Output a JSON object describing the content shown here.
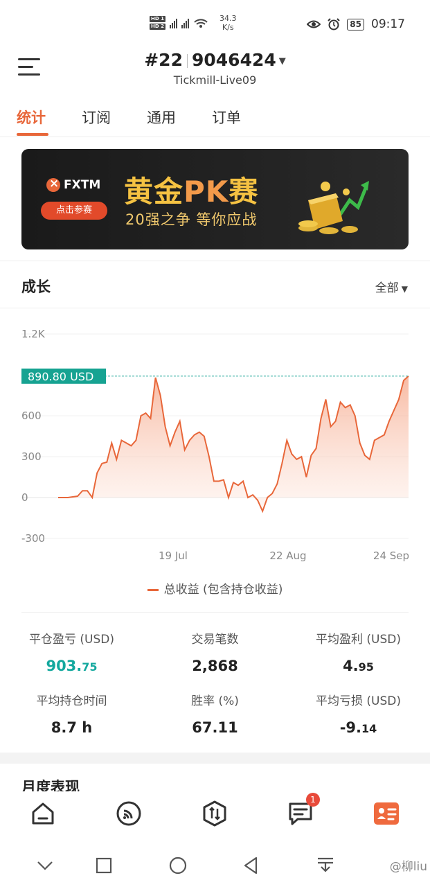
{
  "status_bar": {
    "hd1": "HD 1",
    "hd2": "HD 2",
    "net_speed_value": "34.3",
    "net_speed_unit": "K/s",
    "battery": "85",
    "time": "09:17"
  },
  "header": {
    "account_prefix": "#22",
    "account_number": "9046424",
    "server": "Tickmill-Live09"
  },
  "tabs": [
    {
      "label": "统计",
      "active": true
    },
    {
      "label": "订阅",
      "active": false
    },
    {
      "label": "通用",
      "active": false
    },
    {
      "label": "订单",
      "active": false
    }
  ],
  "banner": {
    "brand": "FXTM",
    "cta": "点击参赛",
    "title_a": "黄金",
    "title_pk": "PK",
    "title_b": "赛",
    "subtitle": "20强之争  等你应战"
  },
  "growth": {
    "title": "成长",
    "filter": "全部"
  },
  "chart_data": {
    "type": "area",
    "y_ticks": [
      "1.2K",
      "600",
      "300",
      "0",
      "-300"
    ],
    "x_ticks": [
      "19 Jul",
      "22 Aug",
      "24 Sep"
    ],
    "ylim": [
      -300,
      1200
    ],
    "current_value_label": "890.80 USD",
    "current_value": 890.8,
    "legend": "总收益 (包含持仓收益)",
    "color": "#e8673a",
    "series": [
      {
        "name": "总收益 (包含持仓收益)",
        "values": [
          0,
          0,
          0,
          5,
          10,
          50,
          50,
          0,
          180,
          250,
          260,
          400,
          280,
          420,
          400,
          380,
          420,
          600,
          620,
          580,
          880,
          750,
          520,
          380,
          480,
          560,
          350,
          420,
          460,
          480,
          450,
          300,
          120,
          120,
          130,
          0,
          110,
          90,
          120,
          0,
          20,
          -20,
          -100,
          0,
          30,
          100,
          250,
          420,
          320,
          280,
          300,
          150,
          310,
          360,
          580,
          720,
          520,
          560,
          700,
          660,
          680,
          600,
          400,
          310,
          280,
          420,
          440,
          460,
          560,
          640,
          720,
          860,
          890.8
        ]
      }
    ]
  },
  "stats": [
    {
      "label": "平仓盈亏 (USD)",
      "value_main": "903.",
      "value_dec": "75",
      "color": "green"
    },
    {
      "label": "交易笔数",
      "value_main": "2,868",
      "value_dec": "",
      "color": "dark"
    },
    {
      "label": "平均盈利 (USD)",
      "value_main": "4.",
      "value_dec": "95",
      "color": "dark"
    },
    {
      "label": "平均持仓时间",
      "value_main": "8.7 h",
      "value_dec": "",
      "color": "dark"
    },
    {
      "label": "胜率 (%)",
      "value_main": "67.11",
      "value_dec": "",
      "color": "dark"
    },
    {
      "label": "平均亏损 (USD)",
      "value_main": "-9.",
      "value_dec": "14",
      "color": "dark"
    }
  ],
  "monthly_title": "月度表现",
  "bottom_nav": {
    "messages_badge": "1"
  },
  "watermark": "@柳liu"
}
